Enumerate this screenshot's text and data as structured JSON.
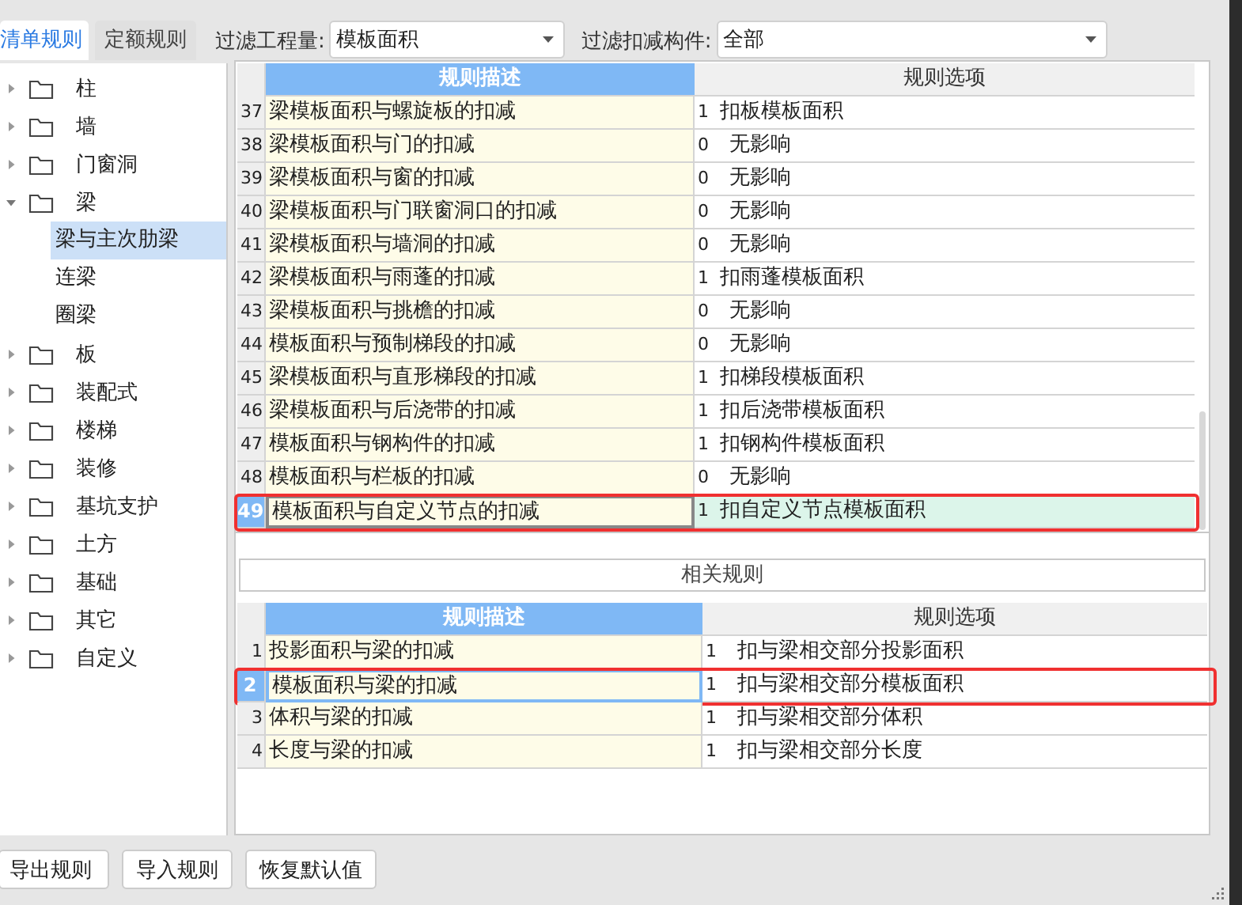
{
  "tabs": [
    {
      "label": "清单规则",
      "selected": true
    },
    {
      "label": "定额规则",
      "selected": false
    }
  ],
  "filters": [
    {
      "label": "过滤工程量:",
      "value": "模板面积"
    },
    {
      "label": "过滤扣减构件:",
      "value": "全部"
    }
  ],
  "tree": [
    {
      "label": "柱",
      "expanded": false,
      "selected": false
    },
    {
      "label": "墙",
      "expanded": false,
      "selected": false
    },
    {
      "label": "门窗洞",
      "expanded": false,
      "selected": false
    },
    {
      "label": "梁",
      "expanded": true,
      "selected": false,
      "children": [
        {
          "label": "梁与主次肋梁",
          "selected": true
        },
        {
          "label": "连梁",
          "selected": false
        },
        {
          "label": "圈梁",
          "selected": false
        }
      ]
    },
    {
      "label": "板",
      "expanded": false,
      "selected": false
    },
    {
      "label": "装配式",
      "expanded": false,
      "selected": false
    },
    {
      "label": "楼梯",
      "expanded": false,
      "selected": false
    },
    {
      "label": "装修",
      "expanded": false,
      "selected": false
    },
    {
      "label": "基坑支护",
      "expanded": false,
      "selected": false
    },
    {
      "label": "土方",
      "expanded": false,
      "selected": false
    },
    {
      "label": "基础",
      "expanded": false,
      "selected": false
    },
    {
      "label": "其它",
      "expanded": false,
      "selected": false
    },
    {
      "label": "自定义",
      "expanded": false,
      "selected": false
    }
  ],
  "rules_table": {
    "focused": true,
    "columns": [
      "规则描述",
      "规则选项"
    ],
    "rows": [
      {
        "no": "37",
        "desc": "梁模板面积与螺旋板的扣减",
        "value": "1",
        "option": "扣板模板面积",
        "selected": false,
        "marked": false
      },
      {
        "no": "38",
        "desc": "梁模板面积与门的扣减",
        "value": "0",
        "option": "无影响",
        "selected": false,
        "marked": false
      },
      {
        "no": "39",
        "desc": "梁模板面积与窗的扣减",
        "value": "0",
        "option": "无影响",
        "selected": false,
        "marked": false
      },
      {
        "no": "40",
        "desc": "梁模板面积与门联窗洞口的扣减",
        "value": "0",
        "option": "无影响",
        "selected": false,
        "marked": false
      },
      {
        "no": "41",
        "desc": "梁模板面积与墙洞的扣减",
        "value": "0",
        "option": "无影响",
        "selected": false,
        "marked": false
      },
      {
        "no": "42",
        "desc": "梁模板面积与雨蓬的扣减",
        "value": "1",
        "option": "扣雨蓬模板面积",
        "selected": false,
        "marked": false
      },
      {
        "no": "43",
        "desc": "梁模板面积与挑檐的扣减",
        "value": "0",
        "option": "无影响",
        "selected": false,
        "marked": false
      },
      {
        "no": "44",
        "desc": "模板面积与预制梯段的扣减",
        "value": "0",
        "option": "无影响",
        "selected": false,
        "marked": false
      },
      {
        "no": "45",
        "desc": "梁模板面积与直形梯段的扣减",
        "value": "1",
        "option": "扣梯段模板面积",
        "selected": false,
        "marked": false
      },
      {
        "no": "46",
        "desc": "梁模板面积与后浇带的扣减",
        "value": "1",
        "option": "扣后浇带模板面积",
        "selected": false,
        "marked": false
      },
      {
        "no": "47",
        "desc": "模板面积与钢构件的扣减",
        "value": "1",
        "option": "扣钢构件模板面积",
        "selected": false,
        "marked": false
      },
      {
        "no": "48",
        "desc": "模板面积与栏板的扣减",
        "value": "0",
        "option": "无影响",
        "selected": false,
        "marked": false
      },
      {
        "no": "49",
        "desc": "模板面积与自定义节点的扣减",
        "value": "1",
        "option": "扣自定义节点模板面积",
        "selected": true,
        "marked": true
      }
    ]
  },
  "related_title": "相关规则",
  "related_table": {
    "focused": false,
    "columns": [
      "规则描述",
      "规则选项"
    ],
    "rows": [
      {
        "no": "1",
        "desc": "投影面积与梁的扣减",
        "value": "1",
        "option": "扣与梁相交部分投影面积",
        "selected": false,
        "marked": false
      },
      {
        "no": "2",
        "desc": "模板面积与梁的扣减",
        "value": "1",
        "option": "扣与梁相交部分模板面积",
        "selected": true,
        "marked": true
      },
      {
        "no": "3",
        "desc": "体积与梁的扣减",
        "value": "1",
        "option": "扣与梁相交部分体积",
        "selected": false,
        "marked": false
      },
      {
        "no": "4",
        "desc": "长度与梁的扣减",
        "value": "1",
        "option": "扣与梁相交部分长度",
        "selected": false,
        "marked": false
      }
    ]
  },
  "buttons": [
    "导出规则",
    "导入规则",
    "恢复默认值"
  ]
}
